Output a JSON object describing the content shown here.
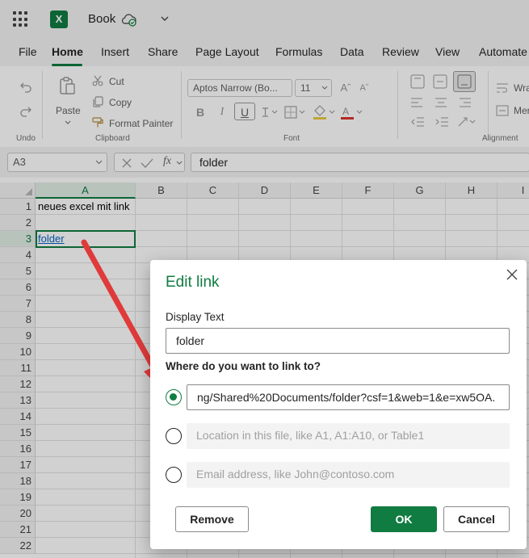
{
  "app": {
    "title": "Book",
    "icons": [
      "waffle-icon",
      "excel-logo",
      "cloud-saved-icon",
      "chevron-down-icon"
    ]
  },
  "ribbon_tabs": [
    "File",
    "Home",
    "Insert",
    "Share",
    "Page Layout",
    "Formulas",
    "Data",
    "Review",
    "View",
    "Automate"
  ],
  "active_tab": "Home",
  "ribbon": {
    "undo_group": "Undo",
    "paste_label": "Paste",
    "cut_label": "Cut",
    "copy_label": "Copy",
    "format_painter_label": "Format Painter",
    "clipboard_group": "Clipboard",
    "font_name": "Aptos Narrow (Bo...",
    "font_size": "11",
    "font_group": "Font",
    "wrap_label": "Wra",
    "merge_label": "Mer",
    "alignment_group": "Alignment"
  },
  "formula_bar": {
    "name_box": "A3",
    "fx": "fx",
    "value": "folder"
  },
  "grid": {
    "columns": [
      "A",
      "B",
      "C",
      "D",
      "E",
      "F",
      "G",
      "H",
      "I"
    ],
    "selected_column": "A",
    "rows": [
      "1",
      "2",
      "3",
      "4",
      "5",
      "6",
      "7",
      "8",
      "9",
      "10",
      "11",
      "12",
      "13",
      "14",
      "15",
      "16",
      "17",
      "18",
      "19",
      "20",
      "21",
      "22"
    ],
    "selected_row": "3",
    "cells": {
      "A1": "neues excel mit link",
      "A3": "folder"
    }
  },
  "dialog": {
    "title": "Edit link",
    "display_text_label": "Display Text",
    "display_text_value": "folder",
    "link_question": "Where do you want to link to?",
    "url_value": "ng/Shared%20Documents/folder?csf=1&web=1&e=xw5OA.",
    "location_placeholder": "Location in this file, like A1, A1:A10, or Table1",
    "email_placeholder": "Email address, like John@contoso.com",
    "remove_label": "Remove",
    "ok_label": "OK",
    "cancel_label": "Cancel",
    "selected_option": "url"
  },
  "colors": {
    "accent": "#107c41",
    "annotation_arrow": "#e03a3a"
  }
}
